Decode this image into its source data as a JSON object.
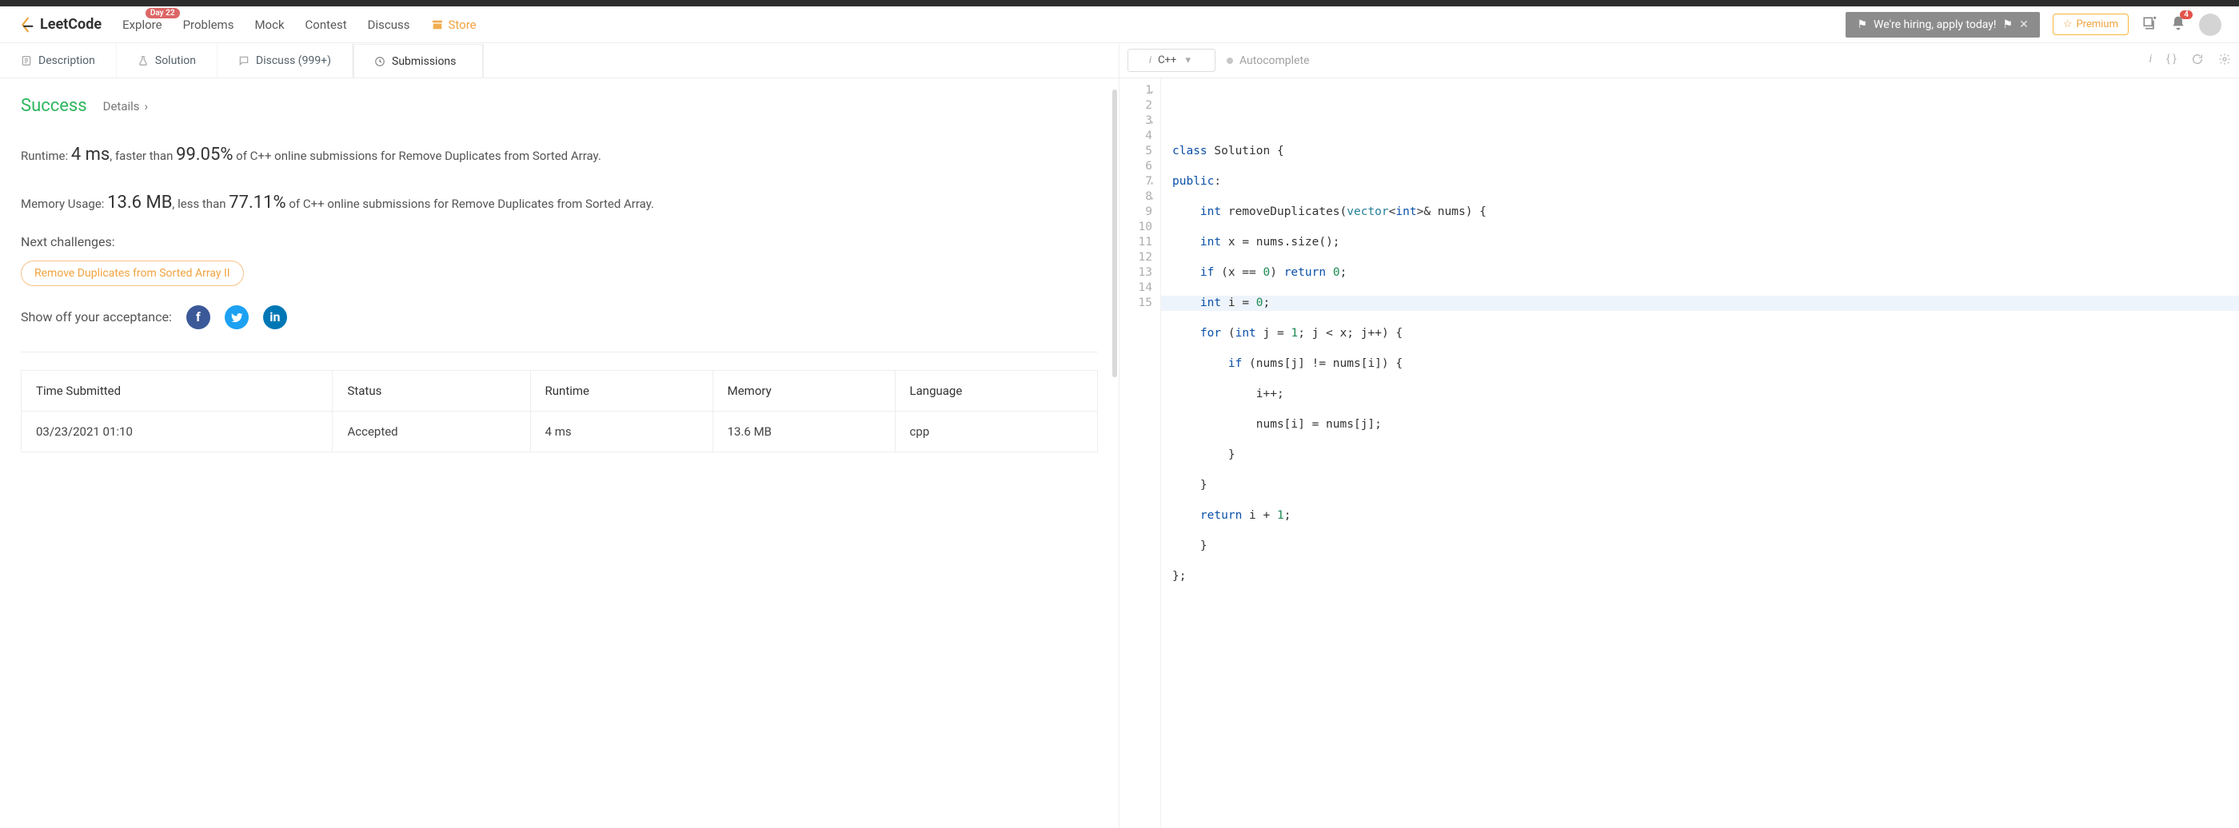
{
  "brand": "LeetCode",
  "nav": {
    "explore": "Explore",
    "problems": "Problems",
    "mock": "Mock",
    "contest": "Contest",
    "discuss": "Discuss",
    "store": "Store",
    "day_badge": "Day 22"
  },
  "banner": {
    "text": "We're hiring, apply today!"
  },
  "premium": "Premium",
  "notifications": "4",
  "tabs": {
    "description": "Description",
    "solution": "Solution",
    "discuss": "Discuss (999+)",
    "submissions": "Submissions"
  },
  "submission": {
    "status": "Success",
    "details": "Details",
    "runtime_label": "Runtime: ",
    "runtime_value": "4 ms",
    "runtime_mid": ", faster than ",
    "runtime_pct": "99.05%",
    "runtime_tail": " of C++ online submissions for Remove Duplicates from Sorted Array.",
    "memory_label": "Memory Usage: ",
    "memory_value": "13.6 MB",
    "memory_mid": ", less than ",
    "memory_pct": "77.11%",
    "memory_tail": " of C++ online submissions for Remove Duplicates from Sorted Array.",
    "next_label": "Next challenges:",
    "next_pill": "Remove Duplicates from Sorted Array II",
    "share_label": "Show off your acceptance:"
  },
  "table": {
    "h_time": "Time Submitted",
    "h_status": "Status",
    "h_runtime": "Runtime",
    "h_memory": "Memory",
    "h_lang": "Language",
    "rows": [
      {
        "time": "03/23/2021 01:10",
        "status": "Accepted",
        "runtime": "4 ms",
        "memory": "13.6 MB",
        "lang": "cpp"
      }
    ]
  },
  "editor": {
    "language": "C++",
    "autocomplete": "Autocomplete",
    "gutter": [
      "1",
      "2",
      "3",
      "4",
      "5",
      "6",
      "7",
      "8",
      "9",
      "10",
      "11",
      "12",
      "13",
      "14",
      "15"
    ],
    "fold_lines": [
      1,
      3,
      7,
      8
    ],
    "code_lines": {
      "l1": {
        "a": "class",
        "b": " Solution {"
      },
      "l2": {
        "a": "public",
        "b": ":"
      },
      "l3": {
        "a": "    ",
        "b": "int",
        "c": " removeDuplicates(",
        "d": "vector",
        "e": "<",
        "f": "int",
        "g": ">& nums) {"
      },
      "l4": {
        "a": "    ",
        "b": "int",
        "c": " x = nums.size();"
      },
      "l5": {
        "a": "    ",
        "b": "if",
        "c": " (x == ",
        "d": "0",
        "e": ") ",
        "f": "return",
        "g": " ",
        "h": "0",
        "i": ";"
      },
      "l6": {
        "a": "    ",
        "b": "int",
        "c": " i = ",
        "d": "0",
        "e": ";"
      },
      "l7": {
        "a": "    ",
        "b": "for",
        "c": " (",
        "d": "int",
        "e": " j = ",
        "f": "1",
        "g": "; j < x; j++) {"
      },
      "l8": {
        "a": "        ",
        "b": "if",
        "c": " (nums[j] != nums[i]) {"
      },
      "l9": {
        "a": "            i++;"
      },
      "l10": {
        "a": "            nums[i] = nums[j];"
      },
      "l11": {
        "a": "        }"
      },
      "l12": {
        "a": "    }"
      },
      "l13": {
        "a": "    ",
        "b": "return",
        "c": " i + ",
        "d": "1",
        "e": ";"
      },
      "l14": {
        "a": "    }"
      },
      "l15": {
        "a": "};"
      }
    }
  }
}
